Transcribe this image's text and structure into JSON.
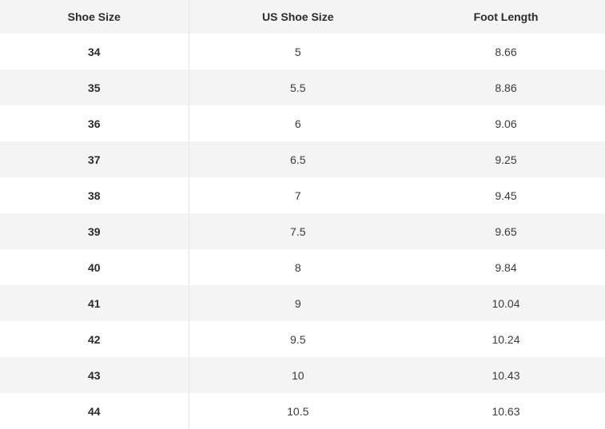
{
  "table": {
    "headers": [
      "Shoe Size",
      "US Shoe Size",
      "Foot Length"
    ],
    "rows": [
      [
        "34",
        "5",
        "8.66"
      ],
      [
        "35",
        "5.5",
        "8.86"
      ],
      [
        "36",
        "6",
        "9.06"
      ],
      [
        "37",
        "6.5",
        "9.25"
      ],
      [
        "38",
        "7",
        "9.45"
      ],
      [
        "39",
        "7.5",
        "9.65"
      ],
      [
        "40",
        "8",
        "9.84"
      ],
      [
        "41",
        "9",
        "10.04"
      ],
      [
        "42",
        "9.5",
        "10.24"
      ],
      [
        "43",
        "10",
        "10.43"
      ],
      [
        "44",
        "10.5",
        "10.63"
      ]
    ]
  }
}
